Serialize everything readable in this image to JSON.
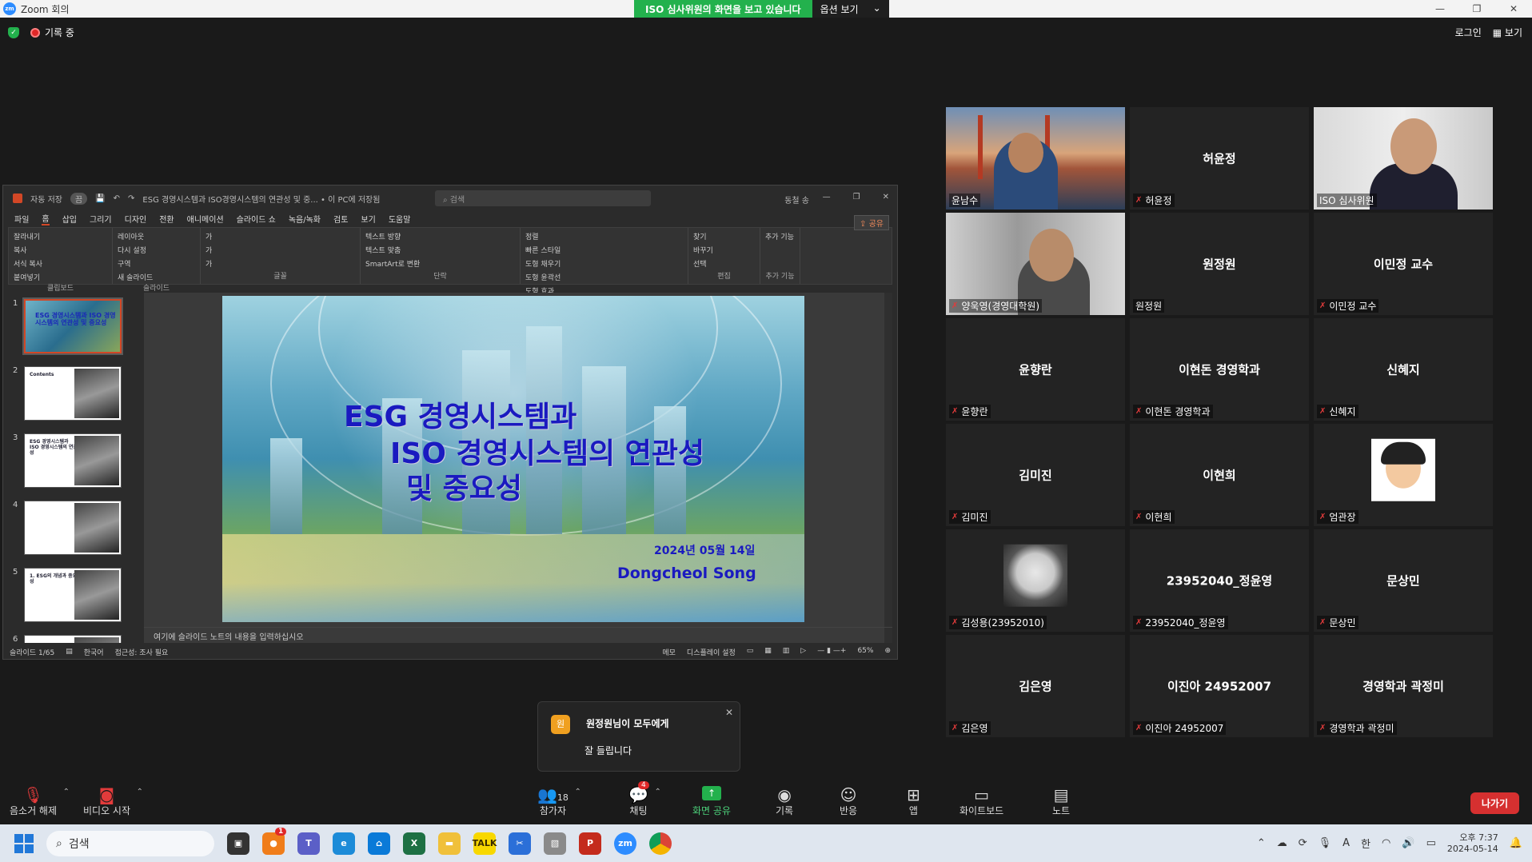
{
  "window": {
    "title": "Zoom 회의",
    "logo": "zm"
  },
  "share_banner": {
    "text": "ISO 심사위원의 화면을 보고 있습니다",
    "options_label": "옵션 보기"
  },
  "top_bar": {
    "recording_label": "기록 중",
    "login_label": "로그인",
    "view_label": "보기"
  },
  "ppt": {
    "autosave_label": "자동 저장",
    "autosave_state": "끔",
    "doc_title": "ESG 경영시스템과 ISO경영시스템의 연관성 및 중... • 이 PC에 저장됨",
    "search_placeholder": "검색",
    "account_name": "동철 송",
    "share_label": "공유",
    "menu": [
      "파일",
      "홈",
      "삽입",
      "그리기",
      "디자인",
      "전환",
      "애니메이션",
      "슬라이드 쇼",
      "녹음/녹화",
      "검토",
      "보기",
      "도움말"
    ],
    "ribbon_groups": [
      {
        "name": "클립보드",
        "items": [
          "잘라내기",
          "복사",
          "서식 복사",
          "붙여넣기"
        ]
      },
      {
        "name": "슬라이드",
        "items": [
          "레이아웃",
          "다시 설정",
          "구역",
          "새 슬라이드"
        ]
      },
      {
        "name": "글꼴",
        "items": [
          "가",
          "가",
          "가"
        ]
      },
      {
        "name": "단락",
        "items": [
          "텍스트 방향",
          "텍스트 맞춤",
          "SmartArt로 변환"
        ]
      },
      {
        "name": "그리기",
        "items": [
          "정렬",
          "빠른 스타일",
          "도형 채우기",
          "도형 윤곽선",
          "도형 효과"
        ]
      },
      {
        "name": "편집",
        "items": [
          "찾기",
          "바꾸기",
          "선택"
        ]
      },
      {
        "name": "추가 기능",
        "items": [
          "추가 기능"
        ]
      }
    ],
    "thumbnails": [
      {
        "num": "1",
        "title": "ESG 경영시스템과 ISO 경영시스템의 연관성 및 중요성"
      },
      {
        "num": "2",
        "title": "Contents"
      },
      {
        "num": "3",
        "title": "ESG 경영시스템과 ISO 경영시스템의 연관성"
      },
      {
        "num": "4",
        "title": ""
      },
      {
        "num": "5",
        "title": "1. ESG의 개념과 중요성"
      },
      {
        "num": "6",
        "title": ""
      }
    ],
    "slide": {
      "line1": "ESG 경영시스템과",
      "line2": "ISO 경영시스템의 연관성",
      "line3": "및 중요성",
      "date": "2024년 05월 14일",
      "author": "Dongcheol Song"
    },
    "notes_placeholder": "여기에 슬라이드 노트의 내용을 입력하십시오",
    "status": {
      "slide_pos": "슬라이드 1/65",
      "language": "한국어",
      "accessibility": "접근성: 조사 필요",
      "notes_btn": "메모",
      "display_settings": "디스플레이 설정",
      "zoom": "65%"
    }
  },
  "participants": [
    {
      "name": "윤남수",
      "display": "",
      "video": "vid1",
      "muted": false
    },
    {
      "name": "허윤정",
      "display": "허윤정",
      "video": "",
      "muted": true
    },
    {
      "name": "ISO 심사위원",
      "display": "",
      "video": "vid3",
      "muted": false,
      "active": true
    },
    {
      "name": "양욱영(경영대학원)",
      "display": "",
      "video": "vid2",
      "muted": true
    },
    {
      "name": "원정원",
      "display": "원정원",
      "video": "",
      "muted": false
    },
    {
      "name": "이민정 교수",
      "display": "이민정 교수",
      "video": "",
      "muted": true
    },
    {
      "name": "윤향란",
      "display": "윤향란",
      "video": "",
      "muted": true
    },
    {
      "name": "이현돈 경영학과",
      "display": "이현돈 경영학과",
      "video": "",
      "muted": true
    },
    {
      "name": "신혜지",
      "display": "신혜지",
      "video": "",
      "muted": true
    },
    {
      "name": "김미진",
      "display": "김미진",
      "video": "",
      "muted": true
    },
    {
      "name": "이현희",
      "display": "이현희",
      "video": "",
      "muted": true
    },
    {
      "name": "엄관장",
      "display": "",
      "video": "avatar-cartoon",
      "muted": true
    },
    {
      "name": "김성용(23952010)",
      "display": "",
      "video": "avatar-watch",
      "muted": true
    },
    {
      "name": "23952040_정윤영",
      "display": "23952040_정윤영",
      "video": "",
      "muted": true
    },
    {
      "name": "문상민",
      "display": "문상민",
      "video": "",
      "muted": true
    },
    {
      "name": "김은영",
      "display": "김은영",
      "video": "",
      "muted": true
    },
    {
      "name": "이진아 24952007",
      "display": "이진아 24952007",
      "video": "",
      "muted": true
    },
    {
      "name": "경영학과 곽정미",
      "display": "경영학과 곽정미",
      "video": "",
      "muted": true
    }
  ],
  "chat_toast": {
    "avatar": "원",
    "from": "원정원님이 모두에게",
    "message": "잘 들립니다"
  },
  "toolbar": {
    "unmute": "음소거 해제",
    "start_video": "비디오 시작",
    "participants": "참가자",
    "participants_count": "18",
    "chat": "채팅",
    "chat_badge": "4",
    "share_screen": "화면 공유",
    "record": "기록",
    "reactions": "반응",
    "apps": "앱",
    "whiteboard": "화이트보드",
    "notes": "노트",
    "leave": "나가기"
  },
  "taskbar": {
    "search_placeholder": "검색",
    "time": "오후 7:37",
    "date": "2024-05-14",
    "ime": "한",
    "notif_badge": "1"
  },
  "colors": {
    "zoom_green": "#23b14d",
    "leave_red": "#d63030",
    "ppt_accent": "#d24726",
    "slide_title": "#1a1ac0"
  }
}
